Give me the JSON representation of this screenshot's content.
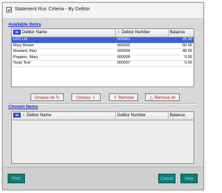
{
  "window": {
    "title": "Statement Run Criteria - By Debtor"
  },
  "available": {
    "label": "Available Items",
    "columns": {
      "indicator": "ID",
      "name": "Debtor Name",
      "number": "Debtor Number",
      "balance": "Balance"
    },
    "rows": [
      {
        "name": "LRS Ltd",
        "number": "000001",
        "balance": "25.00",
        "selected": true
      },
      {
        "name": "Mary Brown",
        "number": "000002",
        "balance": "60.00",
        "selected": false
      },
      {
        "name": "Mustard, Alan",
        "number": "000004",
        "balance": "40.00",
        "selected": false
      },
      {
        "name": "Poppins, Mary",
        "number": "000006",
        "balance": "0.00",
        "selected": false
      },
      {
        "name": "Testy Test",
        "number": "000007",
        "balance": "0.00",
        "selected": false
      }
    ]
  },
  "actions": {
    "choose_all": "Choose All",
    "choose": "Choose",
    "remove": "Remove",
    "remove_all": "Remove All"
  },
  "chosen": {
    "label": "Chosen Items",
    "columns": {
      "indicator": "ID",
      "name": "Debtor Name",
      "number": "Debtor Number",
      "balance": "Balance"
    },
    "rows": []
  },
  "footer": {
    "print": "Print",
    "cancel": "Cancel",
    "help": "Help"
  },
  "colors": {
    "section_label": "#1a2bd0",
    "selection": "#3a62d8",
    "action_text": "#a61b1b",
    "footer_button": "#0f7d79"
  }
}
